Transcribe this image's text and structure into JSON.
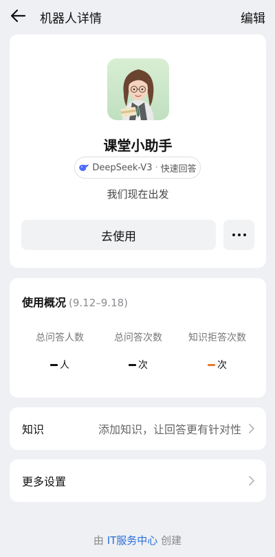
{
  "header": {
    "title": "机器人详情",
    "edit_label": "编辑"
  },
  "profile": {
    "name": "课堂小助手",
    "model": "DeepSeek-V3",
    "model_dot": "·",
    "mode": "快速回答",
    "tagline": "我们现在出发",
    "use_label": "去使用"
  },
  "usage": {
    "title": "使用概况",
    "range": "(9.12–9.18)",
    "stats": [
      {
        "label": "总问答人数",
        "unit": "人",
        "dash_color": "#111111"
      },
      {
        "label": "总问答次数",
        "unit": "次",
        "dash_color": "#111111"
      },
      {
        "label": "知识拒答次数",
        "unit": "次",
        "dash_color": "#e8792a"
      }
    ]
  },
  "knowledge": {
    "label": "知识",
    "description": "添加知识，让回答更有针对性"
  },
  "settings": {
    "label": "更多设置"
  },
  "footer": {
    "prefix": "由",
    "link": "IT服务中心",
    "suffix": "创建"
  }
}
